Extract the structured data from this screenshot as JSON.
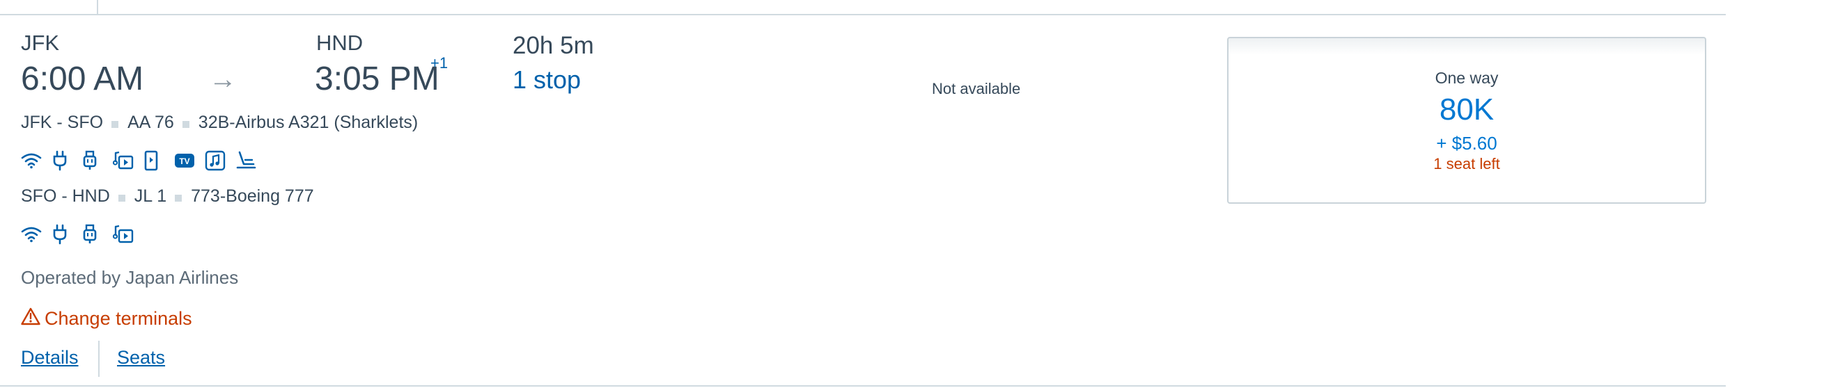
{
  "flight": {
    "depart": {
      "airport": "JFK",
      "time": "6:00 AM"
    },
    "arrive": {
      "airport": "HND",
      "time": "3:05 PM",
      "day_offset": "+1"
    },
    "arrow_glyph": "→",
    "duration": "20h 5m",
    "stops": "1 stop"
  },
  "segments": [
    {
      "route": "JFK - SFO",
      "flight_number": "AA 76",
      "aircraft": "32B-Airbus A321 (Sharklets)",
      "amenities": [
        "wifi-icon",
        "power-outlet-icon",
        "usb-power-icon",
        "entertainment-streaming-icon",
        "seatback-screen-icon",
        "live-tv-icon",
        "audio-entertainment-icon",
        "lie-flat-seat-icon"
      ]
    },
    {
      "route": "SFO - HND",
      "flight_number": "JL 1",
      "aircraft": "773-Boeing 777",
      "amenities": [
        "wifi-icon",
        "power-outlet-icon",
        "usb-power-icon",
        "entertainment-streaming-icon"
      ]
    }
  ],
  "amenity_labels": {
    "live_tv": "TV"
  },
  "operated_by": "Operated by Japan Airlines",
  "warning": {
    "icon": "warning-icon",
    "text": "Change terminals"
  },
  "links": {
    "details": "Details",
    "seats": "Seats"
  },
  "fare_column_1": {
    "text": "Not available"
  },
  "fare_column_2": {
    "label": "One way",
    "miles": "80K",
    "taxes": "+ $5.60",
    "seats_left": "1 seat left"
  },
  "colors": {
    "primary_blue": "#0061ab",
    "price_blue": "#0078d2",
    "text": "#36495a",
    "warning": "#c73d00",
    "divider": "#d0dae0"
  }
}
